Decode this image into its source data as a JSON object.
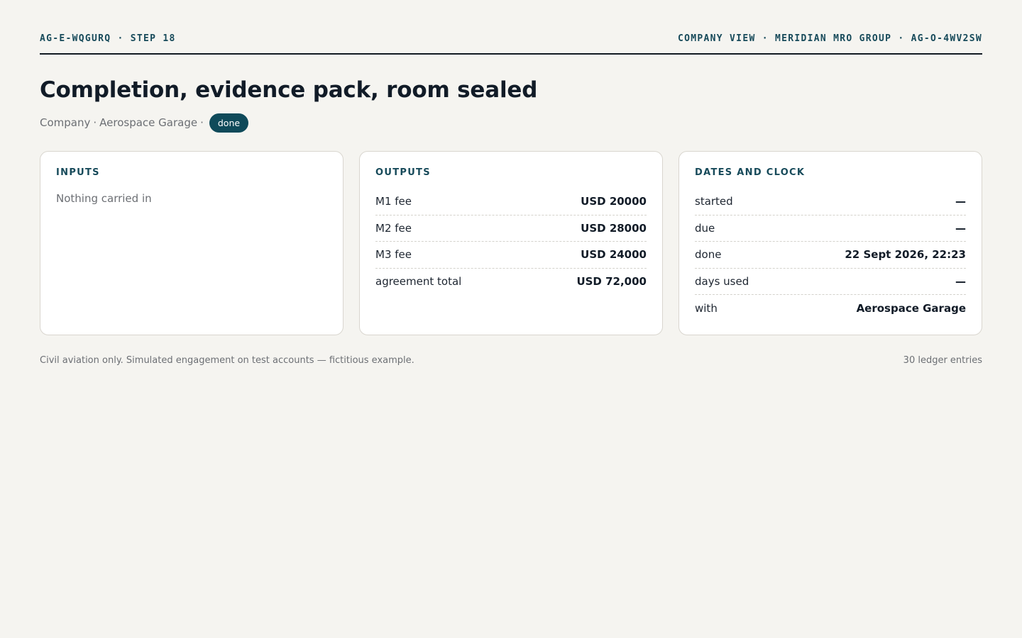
{
  "header": {
    "left": "AG-E-WQGURQ · STEP 18",
    "right": "COMPANY VIEW · MERIDIAN MRO GROUP · AG-O-4WV2SW"
  },
  "title": "Completion, evidence pack, room sealed",
  "subtitle": {
    "role": "Company",
    "counterparty": "Aerospace Garage",
    "separator": "·",
    "status": "done"
  },
  "inputs": {
    "heading": "INPUTS",
    "empty_text": "Nothing carried in"
  },
  "outputs": {
    "heading": "OUTPUTS",
    "rows": [
      {
        "label": "M1 fee",
        "value": "USD 20000"
      },
      {
        "label": "M2 fee",
        "value": "USD 28000"
      },
      {
        "label": "M3 fee",
        "value": "USD 24000"
      },
      {
        "label": "agreement total",
        "value": "USD 72,000"
      }
    ]
  },
  "dates": {
    "heading": "DATES AND CLOCK",
    "rows": [
      {
        "label": "started",
        "value": "—"
      },
      {
        "label": "due",
        "value": "—"
      },
      {
        "label": "done",
        "value": "22 Sept 2026, 22:23"
      },
      {
        "label": "days used",
        "value": "—"
      },
      {
        "label": "with",
        "value": "Aerospace Garage"
      }
    ]
  },
  "footer": {
    "disclaimer": "Civil aviation only. Simulated engagement on test accounts — fictitious example.",
    "ledger": "30 ledger entries"
  }
}
